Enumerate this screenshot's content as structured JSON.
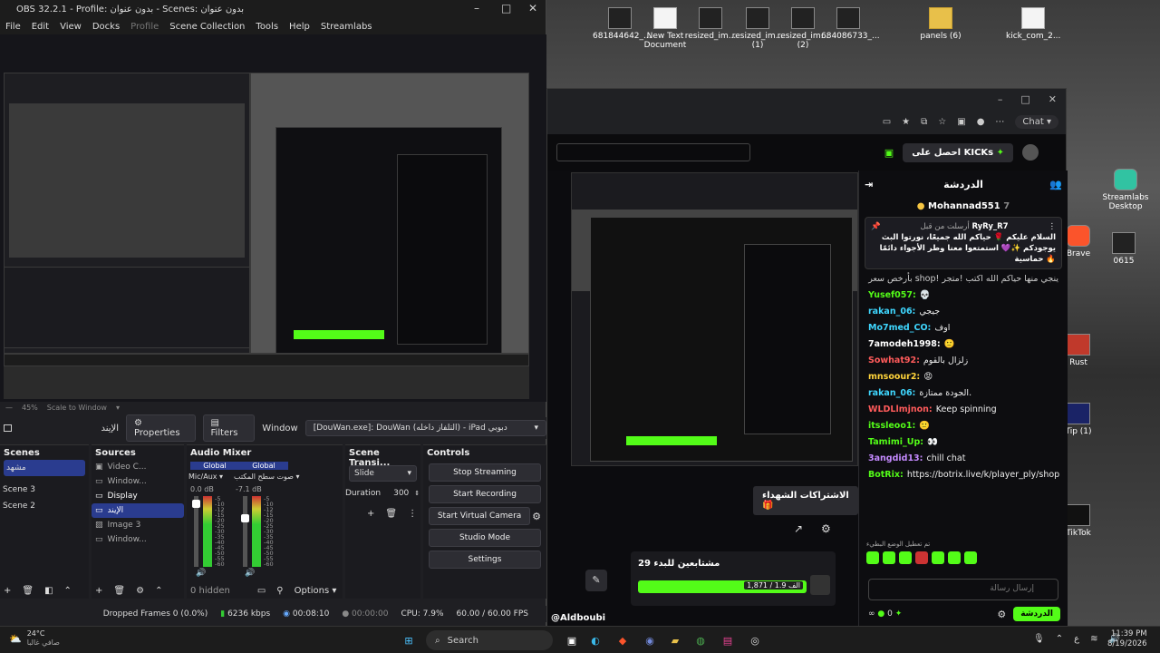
{
  "desktop": {
    "icons": [
      {
        "label": "681844642_..."
      },
      {
        "label": "New Text Document"
      },
      {
        "label": "resized_im..."
      },
      {
        "label": "resized_im... (1)"
      },
      {
        "label": "resized_im... (2)"
      },
      {
        "label": "684086733_..."
      },
      {
        "label": "panels (6)"
      },
      {
        "label": "kick_com_2..."
      },
      {
        "label": "Streamlabs Desktop"
      },
      {
        "label": "Brave"
      },
      {
        "label": "0615"
      },
      {
        "label": "Rust"
      },
      {
        "label": "Tip (1)"
      },
      {
        "label": "TikTok"
      }
    ]
  },
  "obs": {
    "title": "OBS 32.2.1 - Profile: بدون عنوان - Scenes: بدون عنوان",
    "menu": [
      "File",
      "Edit",
      "View",
      "Docks",
      "Profile",
      "Scene Collection",
      "Tools",
      "Help",
      "Streamlabs"
    ],
    "zoom": "45%",
    "scale_to_window": "Scale to Window",
    "source_name": "الإيند",
    "properties": "Properties",
    "filters": "Filters",
    "window_label": "Window",
    "window_value": "[DouWan.exe]: DouWan (التلفاز داخله) - iPad دبوبي",
    "scenes": {
      "title": "Scenes",
      "items": [
        "مشهد",
        "Scene 3",
        "Scene 2"
      ]
    },
    "sources": {
      "title": "Sources",
      "items": [
        "Video C...",
        "Window...",
        "Display",
        "الإيند",
        "Image 3",
        "Window..."
      ]
    },
    "audio": {
      "title": "Audio Mixer",
      "ch1": {
        "tag": "Global",
        "name": "Mic/Aux",
        "db": "0.0 dB"
      },
      "ch2": {
        "tag": "Global",
        "name": "صوت سطح المكتب",
        "db": "-7.1 dB"
      },
      "hidden": "0 hidden",
      "options": "Options",
      "scale": [
        "-5",
        "-10",
        "-12",
        "-15",
        "-20",
        "-25",
        "-30",
        "-35",
        "-40",
        "-45",
        "-50",
        "-55",
        "-60"
      ]
    },
    "transitions": {
      "title": "Scene Transi...",
      "type": "Slide",
      "duration_label": "Duration",
      "duration": "300"
    },
    "controls": {
      "title": "Controls",
      "buttons": [
        "Stop Streaming",
        "Start Recording",
        "Start Virtual Camera",
        "Studio Mode",
        "Settings"
      ]
    },
    "status": {
      "dropped": "Dropped Frames 0 (0.0%)",
      "kbps": "6236 kbps",
      "live": "00:08:10",
      "rec": "00:00:00",
      "cpu": "CPU: 7.9%",
      "fps": "60.00 / 60.00 FPS"
    }
  },
  "browser": {
    "chat_btn": "Chat",
    "get_kicks": "احصل على KICKs",
    "chat_title": "الدردشة",
    "top_gifter": "Mohannad551",
    "top_gifter_count": "7",
    "pinned": {
      "meta": "أرسلت من قبل",
      "user": "RyRy_R7",
      "text": "السلام عليكم 🌹 حياكم الله جميعًا، نورتوا البث يوجودكم ✨💜 استمتعوا معنا وطر الأجواء دائمًا حماسية 🔥",
      "sub": "بأرخص سعر shop! ينجي منها حياكم الله اكتب !متجر"
    },
    "messages": [
      {
        "user": "Yusef057:",
        "text": "💀",
        "color": "#53fc18"
      },
      {
        "user": "rakan_06:",
        "text": "جيجي",
        "color": "#3fd7ff"
      },
      {
        "user": "Mo7med_CO:",
        "text": "اوف",
        "color": "#3fd7ff"
      },
      {
        "user": "7amodeh1998:",
        "text": "🙂",
        "color": "#ffffff"
      },
      {
        "user": "Sowhat92:",
        "text": "زلزال بالقوم",
        "color": "#ff5b5b"
      },
      {
        "user": "mnsoour2:",
        "text": "😡",
        "color": "#ffd43b"
      },
      {
        "user": "rakan_06:",
        "text": "الجودة ممتازة.",
        "color": "#3fd7ff"
      },
      {
        "user": "WLDLlmjnon:",
        "text": "Keep spinning",
        "color": "#ff5b5b"
      },
      {
        "user": "itssleoo1:",
        "text": "🙂",
        "color": "#53fc18"
      },
      {
        "user": "Tamimi_Up:",
        "text": "👀",
        "color": "#53fc18"
      },
      {
        "user": "3angdid13:",
        "text": "chill chat",
        "color": "#c58aff"
      },
      {
        "user": "BotRix:",
        "text": "https://botrix.live/k/player_ply/shop",
        "color": "#53fc18"
      }
    ],
    "emote_hint": "تم تعطيل الوضع البطيء",
    "input_placeholder": "إرسال رسالة",
    "chat_button": "الدردشة",
    "points": "0",
    "subs_button": "الاشتراكات الشهداء",
    "goal_title": "مشتابعين للبدء 29",
    "goal_value": "1,871 / 1.9 الف",
    "channel": "@Aldboubi"
  },
  "taskbar": {
    "weather_temp": "24°C",
    "weather_desc": "صافي غالبا",
    "search": "Search",
    "time": "11:39 PM",
    "date": "8/19/2026",
    "lang": "ع"
  }
}
